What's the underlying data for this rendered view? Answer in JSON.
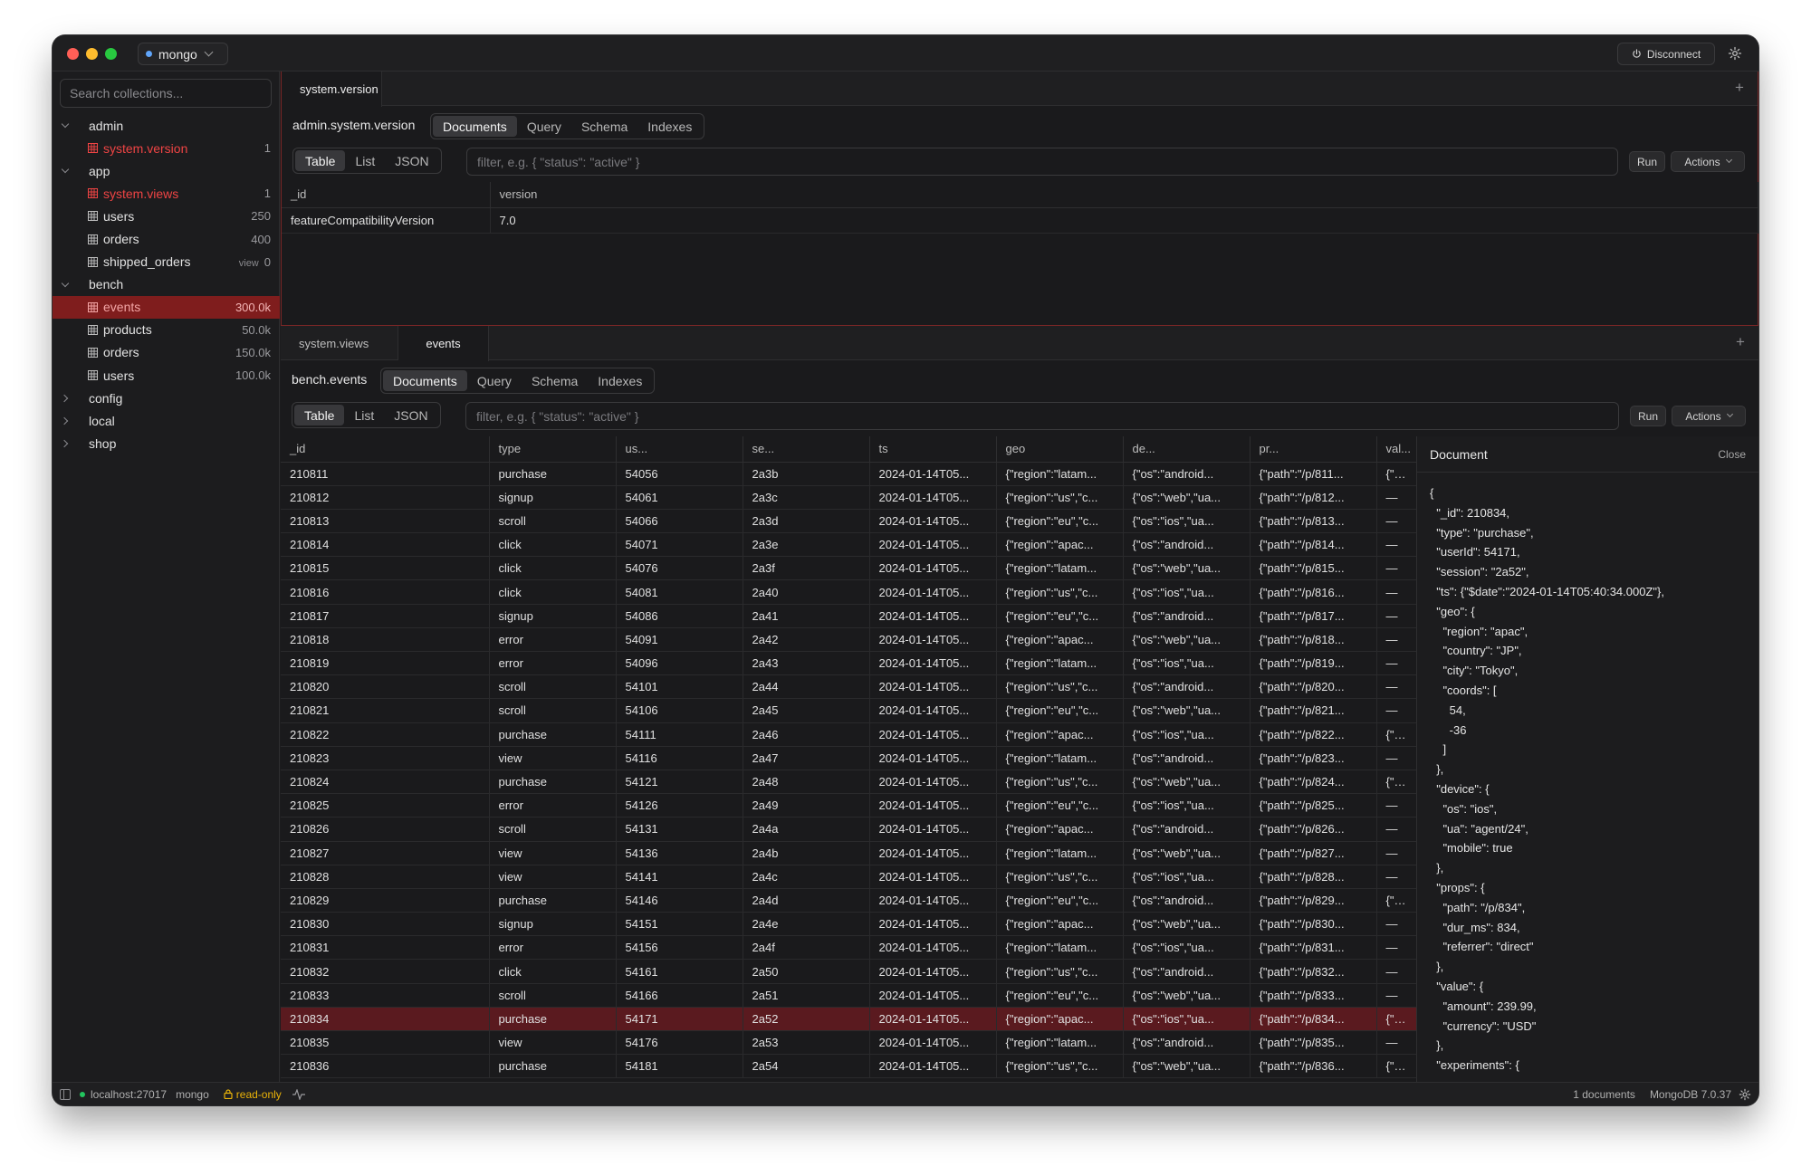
{
  "titlebar": {
    "connection": "mongo",
    "disconnect_label": "Disconnect"
  },
  "sidebar": {
    "search_placeholder": "Search collections...",
    "tree": [
      {
        "kind": "db",
        "label": "admin",
        "expanded": true
      },
      {
        "kind": "coll",
        "label": "system.version",
        "count": "1",
        "system": true
      },
      {
        "kind": "db",
        "label": "app",
        "expanded": true
      },
      {
        "kind": "coll",
        "label": "system.views",
        "count": "1",
        "system": true
      },
      {
        "kind": "coll",
        "label": "users",
        "count": "250"
      },
      {
        "kind": "coll",
        "label": "orders",
        "count": "400"
      },
      {
        "kind": "coll",
        "label": "shipped_orders",
        "count": "0",
        "view": "view"
      },
      {
        "kind": "db",
        "label": "bench",
        "expanded": true
      },
      {
        "kind": "coll",
        "label": "events",
        "count": "300.0k",
        "selected": true
      },
      {
        "kind": "coll",
        "label": "products",
        "count": "50.0k"
      },
      {
        "kind": "coll",
        "label": "orders",
        "count": "150.0k"
      },
      {
        "kind": "coll",
        "label": "users",
        "count": "100.0k"
      },
      {
        "kind": "db",
        "label": "config",
        "expanded": false
      },
      {
        "kind": "db",
        "label": "local",
        "expanded": false
      },
      {
        "kind": "db",
        "label": "shop",
        "expanded": false
      }
    ]
  },
  "top_pane": {
    "tab": "system.version",
    "namespace": "admin.system.version",
    "mode_tabs": [
      "Documents",
      "Query",
      "Schema",
      "Indexes"
    ],
    "view_tabs": [
      "Table",
      "List",
      "JSON"
    ],
    "filter_placeholder": "filter, e.g. { \"status\": \"active\" }",
    "run_label": "Run",
    "actions_label": "Actions",
    "columns": [
      "_id",
      "version"
    ],
    "rows": [
      [
        "featureCompatibilityVersion",
        "7.0"
      ]
    ]
  },
  "bottom_pane": {
    "tabs": [
      "system.views",
      "events"
    ],
    "namespace": "bench.events",
    "mode_tabs": [
      "Documents",
      "Query",
      "Schema",
      "Indexes"
    ],
    "view_tabs": [
      "Table",
      "List",
      "JSON"
    ],
    "filter_placeholder": "filter, e.g. { \"status\": \"active\" }",
    "run_label": "Run",
    "actions_label": "Actions",
    "columns": [
      "_id",
      "type",
      "us...",
      "se...",
      "ts",
      "geo",
      "de...",
      "pr...",
      "val..."
    ],
    "selected_id": "210834",
    "rows": [
      [
        "210811",
        "purchase",
        "54056",
        "2a3b",
        "2024-01-14T05...",
        "{\"region\":\"latam...",
        "{\"os\":\"android...",
        "{\"path\":\"/p/811...",
        "{\"amo"
      ],
      [
        "210812",
        "signup",
        "54061",
        "2a3c",
        "2024-01-14T05...",
        "{\"region\":\"us\",\"c...",
        "{\"os\":\"web\",\"ua...",
        "{\"path\":\"/p/812...",
        "—"
      ],
      [
        "210813",
        "scroll",
        "54066",
        "2a3d",
        "2024-01-14T05...",
        "{\"region\":\"eu\",\"c...",
        "{\"os\":\"ios\",\"ua...",
        "{\"path\":\"/p/813...",
        "—"
      ],
      [
        "210814",
        "click",
        "54071",
        "2a3e",
        "2024-01-14T05...",
        "{\"region\":\"apac...",
        "{\"os\":\"android...",
        "{\"path\":\"/p/814...",
        "—"
      ],
      [
        "210815",
        "click",
        "54076",
        "2a3f",
        "2024-01-14T05...",
        "{\"region\":\"latam...",
        "{\"os\":\"web\",\"ua...",
        "{\"path\":\"/p/815...",
        "—"
      ],
      [
        "210816",
        "click",
        "54081",
        "2a40",
        "2024-01-14T05...",
        "{\"region\":\"us\",\"c...",
        "{\"os\":\"ios\",\"ua...",
        "{\"path\":\"/p/816...",
        "—"
      ],
      [
        "210817",
        "signup",
        "54086",
        "2a41",
        "2024-01-14T05...",
        "{\"region\":\"eu\",\"c...",
        "{\"os\":\"android...",
        "{\"path\":\"/p/817...",
        "—"
      ],
      [
        "210818",
        "error",
        "54091",
        "2a42",
        "2024-01-14T05...",
        "{\"region\":\"apac...",
        "{\"os\":\"web\",\"ua...",
        "{\"path\":\"/p/818...",
        "—"
      ],
      [
        "210819",
        "error",
        "54096",
        "2a43",
        "2024-01-14T05...",
        "{\"region\":\"latam...",
        "{\"os\":\"ios\",\"ua...",
        "{\"path\":\"/p/819...",
        "—"
      ],
      [
        "210820",
        "scroll",
        "54101",
        "2a44",
        "2024-01-14T05...",
        "{\"region\":\"us\",\"c...",
        "{\"os\":\"android...",
        "{\"path\":\"/p/820...",
        "—"
      ],
      [
        "210821",
        "scroll",
        "54106",
        "2a45",
        "2024-01-14T05...",
        "{\"region\":\"eu\",\"c...",
        "{\"os\":\"web\",\"ua...",
        "{\"path\":\"/p/821...",
        "—"
      ],
      [
        "210822",
        "purchase",
        "54111",
        "2a46",
        "2024-01-14T05...",
        "{\"region\":\"apac...",
        "{\"os\":\"ios\",\"ua...",
        "{\"path\":\"/p/822...",
        "{\"amo"
      ],
      [
        "210823",
        "view",
        "54116",
        "2a47",
        "2024-01-14T05...",
        "{\"region\":\"latam...",
        "{\"os\":\"android...",
        "{\"path\":\"/p/823...",
        "—"
      ],
      [
        "210824",
        "purchase",
        "54121",
        "2a48",
        "2024-01-14T05...",
        "{\"region\":\"us\",\"c...",
        "{\"os\":\"web\",\"ua...",
        "{\"path\":\"/p/824...",
        "{\"amo"
      ],
      [
        "210825",
        "error",
        "54126",
        "2a49",
        "2024-01-14T05...",
        "{\"region\":\"eu\",\"c...",
        "{\"os\":\"ios\",\"ua...",
        "{\"path\":\"/p/825...",
        "—"
      ],
      [
        "210826",
        "scroll",
        "54131",
        "2a4a",
        "2024-01-14T05...",
        "{\"region\":\"apac...",
        "{\"os\":\"android...",
        "{\"path\":\"/p/826...",
        "—"
      ],
      [
        "210827",
        "view",
        "54136",
        "2a4b",
        "2024-01-14T05...",
        "{\"region\":\"latam...",
        "{\"os\":\"web\",\"ua...",
        "{\"path\":\"/p/827...",
        "—"
      ],
      [
        "210828",
        "view",
        "54141",
        "2a4c",
        "2024-01-14T05...",
        "{\"region\":\"us\",\"c...",
        "{\"os\":\"ios\",\"ua...",
        "{\"path\":\"/p/828...",
        "—"
      ],
      [
        "210829",
        "purchase",
        "54146",
        "2a4d",
        "2024-01-14T05...",
        "{\"region\":\"eu\",\"c...",
        "{\"os\":\"android...",
        "{\"path\":\"/p/829...",
        "{\"amo"
      ],
      [
        "210830",
        "signup",
        "54151",
        "2a4e",
        "2024-01-14T05...",
        "{\"region\":\"apac...",
        "{\"os\":\"web\",\"ua...",
        "{\"path\":\"/p/830...",
        "—"
      ],
      [
        "210831",
        "error",
        "54156",
        "2a4f",
        "2024-01-14T05...",
        "{\"region\":\"latam...",
        "{\"os\":\"ios\",\"ua...",
        "{\"path\":\"/p/831...",
        "—"
      ],
      [
        "210832",
        "click",
        "54161",
        "2a50",
        "2024-01-14T05...",
        "{\"region\":\"us\",\"c...",
        "{\"os\":\"android...",
        "{\"path\":\"/p/832...",
        "—"
      ],
      [
        "210833",
        "scroll",
        "54166",
        "2a51",
        "2024-01-14T05...",
        "{\"region\":\"eu\",\"c...",
        "{\"os\":\"web\",\"ua...",
        "{\"path\":\"/p/833...",
        "—"
      ],
      [
        "210834",
        "purchase",
        "54171",
        "2a52",
        "2024-01-14T05...",
        "{\"region\":\"apac...",
        "{\"os\":\"ios\",\"ua...",
        "{\"path\":\"/p/834...",
        "{\"amo"
      ],
      [
        "210835",
        "view",
        "54176",
        "2a53",
        "2024-01-14T05...",
        "{\"region\":\"latam...",
        "{\"os\":\"android...",
        "{\"path\":\"/p/835...",
        "—"
      ],
      [
        "210836",
        "purchase",
        "54181",
        "2a54",
        "2024-01-14T05...",
        "{\"region\":\"us\",\"c...",
        "{\"os\":\"web\",\"ua...",
        "{\"path\":\"/p/836...",
        "{\"amo"
      ]
    ]
  },
  "document_panel": {
    "title": "Document",
    "close_label": "Close",
    "json_lines": [
      "{",
      "  \"_id\": 210834,",
      "  \"type\": \"purchase\",",
      "  \"userId\": 54171,",
      "  \"session\": \"2a52\",",
      "  \"ts\": {\"$date\":\"2024-01-14T05:40:34.000Z\"},",
      "  \"geo\": {",
      "    \"region\": \"apac\",",
      "    \"country\": \"JP\",",
      "    \"city\": \"Tokyo\",",
      "    \"coords\": [",
      "      54,",
      "      -36",
      "    ]",
      "  },",
      "  \"device\": {",
      "    \"os\": \"ios\",",
      "    \"ua\": \"agent/24\",",
      "    \"mobile\": true",
      "  },",
      "  \"props\": {",
      "    \"path\": \"/p/834\",",
      "    \"dur_ms\": 834,",
      "    \"referrer\": \"direct\"",
      "  },",
      "  \"value\": {",
      "    \"amount\": 239.99,",
      "    \"currency\": \"USD\"",
      "  },",
      "  \"experiments\": {"
    ]
  },
  "statusbar": {
    "host": "localhost:27017",
    "connection": "mongo",
    "mode": "read-only",
    "doc_count": "1 documents",
    "server_version": "MongoDB 7.0.37"
  },
  "colors": {
    "window_bg": "#1c1c1e",
    "system_collection": "#ef4444",
    "selected_sidebar": "#7f1d1d",
    "selected_row": "#5a1a1f",
    "readonly": "#eab308",
    "connected": "#22c55e"
  }
}
